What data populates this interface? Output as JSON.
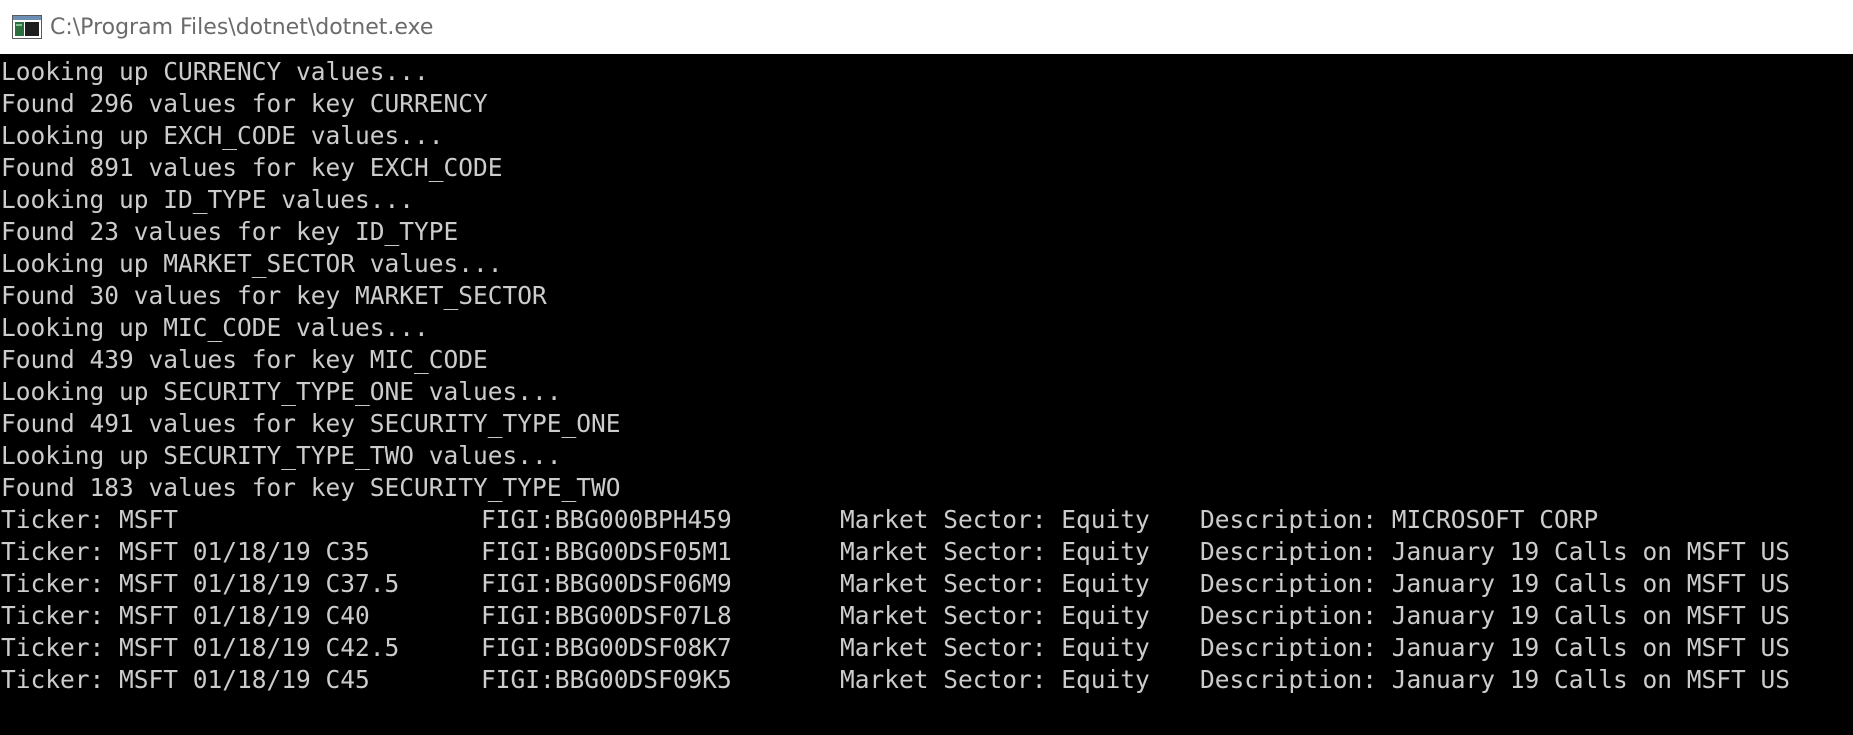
{
  "window": {
    "title": "C:\\Program Files\\dotnet\\dotnet.exe",
    "icon": "console-app-icon"
  },
  "console": {
    "text_color": "#cccccc",
    "background": "#000000",
    "lines": [
      "Looking up CURRENCY values...",
      "Found 296 values for key CURRENCY",
      "Looking up EXCH_CODE values...",
      "Found 891 values for key EXCH_CODE",
      "Looking up ID_TYPE values...",
      "Found 23 values for key ID_TYPE",
      "Looking up MARKET_SECTOR values...",
      "Found 30 values for key MARKET_SECTOR",
      "Looking up MIC_CODE values...",
      "Found 439 values for key MIC_CODE",
      "Looking up SECURITY_TYPE_ONE values...",
      "Found 491 values for key SECURITY_TYPE_ONE",
      "Looking up SECURITY_TYPE_TWO values...",
      "Found 183 values for key SECURITY_TYPE_TWO"
    ],
    "results": [
      {
        "ticker": "Ticker: MSFT",
        "figi": "FIGI:BBG000BPH459",
        "sector": "Market Sector: Equity",
        "description": "Description: MICROSOFT CORP"
      },
      {
        "ticker": "Ticker: MSFT 01/18/19 C35",
        "figi": "FIGI:BBG00DSF05M1",
        "sector": "Market Sector: Equity",
        "description": "Description: January 19 Calls on MSFT US"
      },
      {
        "ticker": "Ticker: MSFT 01/18/19 C37.5",
        "figi": "FIGI:BBG00DSF06M9",
        "sector": "Market Sector: Equity",
        "description": "Description: January 19 Calls on MSFT US"
      },
      {
        "ticker": "Ticker: MSFT 01/18/19 C40",
        "figi": "FIGI:BBG00DSF07L8",
        "sector": "Market Sector: Equity",
        "description": "Description: January 19 Calls on MSFT US"
      },
      {
        "ticker": "Ticker: MSFT 01/18/19 C42.5",
        "figi": "FIGI:BBG00DSF08K7",
        "sector": "Market Sector: Equity",
        "description": "Description: January 19 Calls on MSFT US"
      },
      {
        "ticker": "Ticker: MSFT 01/18/19 C45",
        "figi": "FIGI:BBG00DSF09K5",
        "sector": "Market Sector: Equity",
        "description": "Description: January 19 Calls on MSFT US"
      }
    ]
  }
}
